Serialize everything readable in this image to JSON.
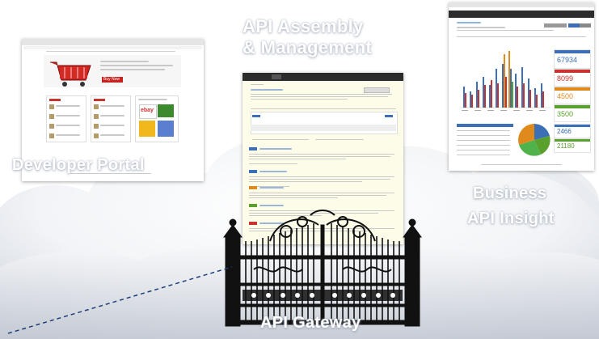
{
  "labels": {
    "developer_portal": "Developer Portal",
    "api_assembly_line1": "API Assembly",
    "api_assembly_line2": "& Management",
    "business_insight_line1": "Business",
    "business_insight_line2": "API Insight",
    "api_gateway": "API Gateway"
  },
  "portal": {
    "banner_button": "Buy Now",
    "panel_ads": "ebay"
  },
  "insight": {
    "metrics": [
      "67934",
      "8099",
      "4500",
      "3500",
      "2466",
      "21180"
    ]
  },
  "colors": {
    "cloud": "#dfe3ea",
    "label_shadow": "#a8b0bf",
    "dark_bar": "#2c2c2c",
    "panel_yellow": "#fdfce8",
    "blue_tag": "#3b6fb6",
    "green_tag": "#5aa02c",
    "orange_tag": "#e08a1e",
    "red_tag": "#c8332f",
    "dashed_line": "#1f3f78"
  },
  "icons": [
    "shopping-cart-icon",
    "gate-icon",
    "pie-chart-icon",
    "bar-chart-icon"
  ]
}
